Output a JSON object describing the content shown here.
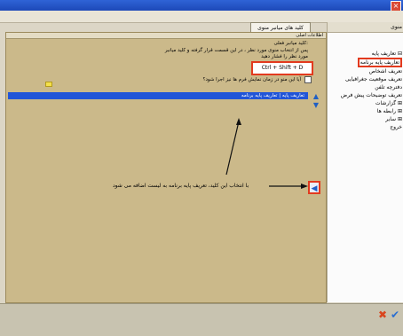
{
  "window": {
    "close_glyph": "×"
  },
  "sidebar": {
    "header": "منوی",
    "items": [
      {
        "label": "تعاریف پایه ⊟"
      },
      {
        "label": "تعاریف پایه برنامه"
      },
      {
        "label": "تعریف اشخاص"
      },
      {
        "label": "تعریف موقعیت جغرافیایی"
      },
      {
        "label": "دفترچه تلفن"
      },
      {
        "label": "تعریف توضیحات پیش فرض"
      },
      {
        "label": "گزارشات ⊞"
      },
      {
        "label": "رابطه ها ⊞"
      },
      {
        "label": "سایر ⊞"
      },
      {
        "label": "خروج"
      }
    ]
  },
  "tab": {
    "label": "کلید های میانبر منوی اصلی"
  },
  "panel": {
    "section_title": "اطلاعات اصلی",
    "key_label": "کلید میانبر فعلی:",
    "help_text": "پس از انتخاب منوی مورد نظر ، در این قسمت قرار گرفته و کلید میانبر",
    "help_text2": "مورد نظر را فشار دهید",
    "shortcut_value": "Ctrl + Shift + D",
    "checkbox_label": "آیا این منو در زمان نمایش فرم ها نیز اجرا شود؟"
  },
  "list": {
    "rows": [
      {
        "text": "تعاریف پایه | تعاریف پایه برنامه"
      }
    ]
  },
  "annotation": {
    "text": "با انتخاب این کلید، تعریف پایه برنامه به لیست اضافه می شود"
  },
  "colors": {
    "highlight": "#e23a1e",
    "selection": "#2155d8",
    "panel": "#cbb98a"
  },
  "icons": {
    "move_up": "up-arrow-icon",
    "move_down": "down-arrow-icon",
    "add": "left-arrow-icon",
    "cancel": "cancel-icon",
    "confirm": "confirm-icon"
  }
}
